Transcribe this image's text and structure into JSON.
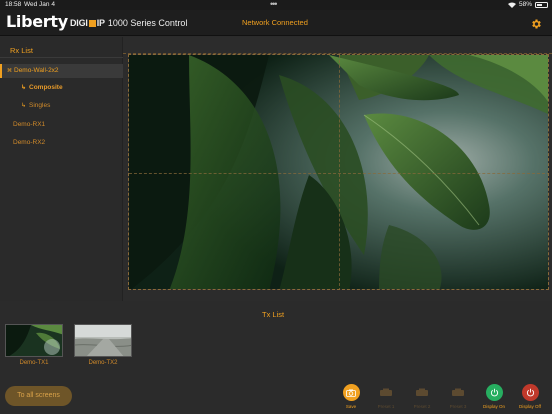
{
  "statusbar": {
    "time": "18:58",
    "date": "Wed Jan 4",
    "battery": "58%",
    "battery_level": 0.58
  },
  "header": {
    "logo": "Liberty",
    "product_brand": "DIGI",
    "product_brand2": "IP",
    "product_model": "1000 Series Control",
    "network_status": "Network Connected"
  },
  "rx_list": {
    "title": "Rx List",
    "items": [
      {
        "label": "Demo-Wall-2x2"
      },
      {
        "label": "Composite"
      },
      {
        "label": "Singles"
      },
      {
        "label": "Demo-RX1"
      },
      {
        "label": "Demo-RX2"
      }
    ]
  },
  "tx_list": {
    "title": "Tx List",
    "items": [
      {
        "label": "Demo-TX1"
      },
      {
        "label": "Demo-TX2"
      }
    ]
  },
  "toolbar": {
    "to_all_screens": "To all screens",
    "save": "Save",
    "preset1": "Preset 1",
    "preset2": "Preset 2",
    "preset3": "Preset 3",
    "display_on": "Display On",
    "display_off": "Display Off"
  },
  "colors": {
    "accent": "#f0a020",
    "display_on": "#27ae60",
    "display_off": "#c0392b"
  }
}
